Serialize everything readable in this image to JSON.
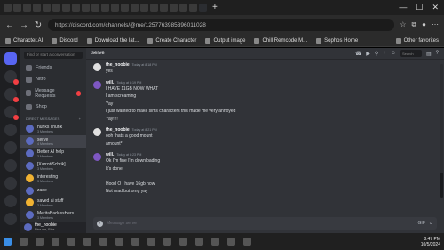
{
  "browser": {
    "tab_add": "+",
    "win_controls": [
      "—",
      "☐",
      "✕"
    ],
    "url": "https://discord.com/channels/@me/1257763985396011028",
    "nav": [
      "←",
      "→",
      "↻"
    ],
    "bookmarks": [
      "Character.AI",
      "Discord",
      "Download the lat...",
      "Create Character",
      "Output image",
      "Chill Remcode M...",
      "Sophos Home"
    ],
    "other_favorites": "Other favorites"
  },
  "dm": {
    "search_placeholder": "Find or start a conversation",
    "nav": [
      {
        "label": "Friends"
      },
      {
        "label": "Nitro"
      },
      {
        "label": "Message Requests"
      },
      {
        "label": "Shop"
      }
    ],
    "section": "DIRECT MESSAGES",
    "section_plus": "+",
    "items": [
      {
        "name": "hunks chunk",
        "sub": "3 Members"
      },
      {
        "name": "serve",
        "sub": "4 Members"
      },
      {
        "name": "Better AI help",
        "sub": "3 Members"
      },
      {
        "name": "[Xarrot/Schrik]",
        "sub": "3 Members"
      },
      {
        "name": "interesting",
        "sub": "3 Members"
      },
      {
        "name": "zade",
        "sub": ""
      },
      {
        "name": "saved ai stuff",
        "sub": "3 Members"
      },
      {
        "name": "MeritaBadassHers",
        "sub": "3 Members"
      }
    ],
    "user": {
      "name": "the_noobie",
      "status": "Rise me, Rise..."
    }
  },
  "channel": {
    "name": "serve",
    "search_placeholder": "Search"
  },
  "messages": [
    {
      "author": "the_noobie",
      "time": "Today at 8:18 PM",
      "lines": [
        "yes"
      ]
    },
    {
      "author": "will.",
      "time": "Today at 8:19 PM",
      "lines": [
        "I HAVE 11GB NOW WHAT",
        "I am screaming",
        "Yay",
        "I just wanted to make sims characters this made me very annoyed",
        "Yay!!!!"
      ]
    },
    {
      "author": "the_noobie",
      "time": "Today at 8:21 PM",
      "lines": [
        "ooh thats a good mount",
        "amount*"
      ]
    },
    {
      "author": "will.",
      "time": "Today at 8:23 PM",
      "lines": [
        "Ok I'm fine I'm downloading",
        "It's done.",
        "",
        "Hood O I have 16gb now",
        "Not mad but omg yay"
      ]
    }
  ],
  "composer": {
    "placeholder": "Message serve",
    "plus": "+",
    "tools": [
      "GIF",
      "☺"
    ]
  },
  "taskbar": {
    "time": "8:47 PM",
    "date": "10/5/2024"
  }
}
